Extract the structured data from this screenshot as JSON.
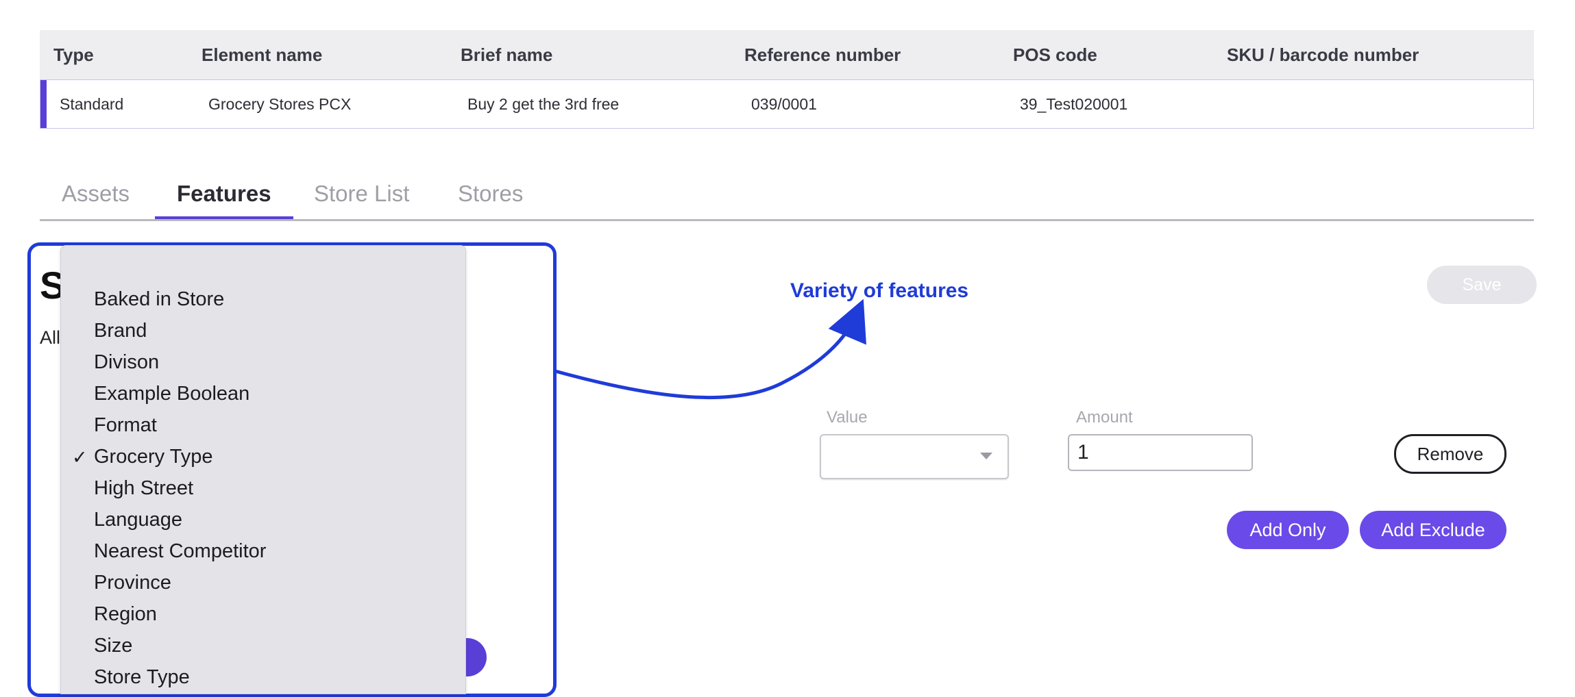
{
  "table": {
    "headers": [
      "Type",
      "Element name",
      "Brief name",
      "Reference number",
      "POS code",
      "SKU / barcode number"
    ],
    "row": [
      "Standard",
      "Grocery Stores PCX",
      "Buy 2 get the 3rd free",
      "039/0001",
      "39_Test020001",
      ""
    ]
  },
  "tabs": [
    "Assets",
    "Features",
    "Store List",
    "Stores"
  ],
  "active_tab": "Features",
  "background": {
    "heading_fragment": "S",
    "subtext_fragment": "All"
  },
  "form": {
    "save_label": "Save",
    "value_label": "Value",
    "amount_label": "Amount",
    "amount_value": "1",
    "remove_label": "Remove",
    "add_only_label": "Add Only",
    "add_exclude_label": "Add Exclude"
  },
  "annotation": {
    "text": "Variety of features",
    "color": "#1f3bd8"
  },
  "dropdown": {
    "items": [
      "Baked in Store",
      "Brand",
      "Divison",
      "Example Boolean",
      "Format",
      "Grocery Type",
      "High Street",
      "Language",
      "Nearest Competitor",
      "Province",
      "Region",
      "Size",
      "Store Type"
    ],
    "selected": "Grocery Type",
    "check_glyph": "✓"
  },
  "colors": {
    "accent": "#5a3fd6",
    "button": "#6a4ae8"
  }
}
